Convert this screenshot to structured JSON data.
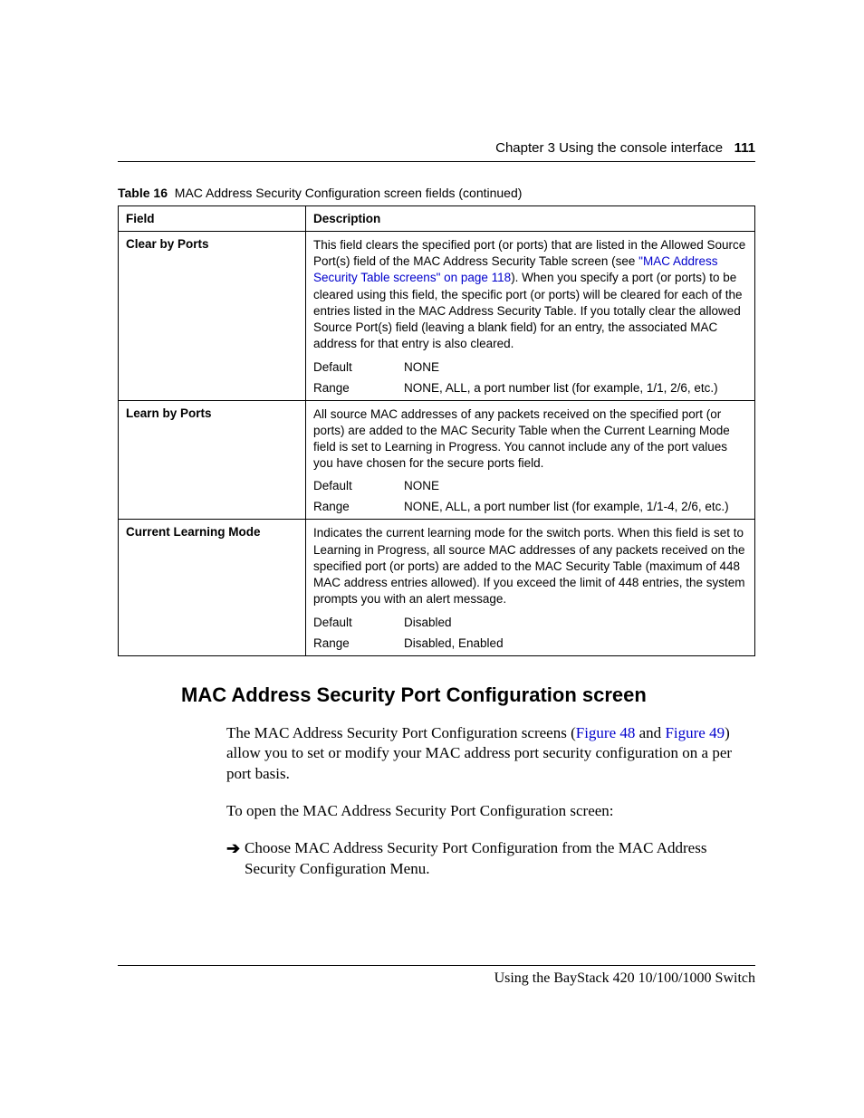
{
  "header": {
    "chapter": "Chapter 3  Using the console interface",
    "page": "111"
  },
  "table": {
    "caption_label": "Table 16",
    "caption_text": "MAC Address Security Configuration screen fields (continued)",
    "col_field": "Field",
    "col_desc": "Description",
    "rows": [
      {
        "field": "Clear by Ports",
        "desc_pre": "This field clears the specified port (or ports) that are listed in the Allowed Source Port(s) field of the MAC Address Security Table screen (see ",
        "link": "\"MAC Address Security Table screens\" on page 118",
        "desc_post": "). When you specify a port (or ports) to be cleared using this field, the specific port (or ports) will be cleared for each of the entries listed in the MAC Address Security Table. If you totally clear the allowed Source Port(s) field (leaving a blank field) for an entry, the associated MAC address for that entry is also cleared.",
        "default_label": "Default",
        "default_value": "NONE",
        "range_label": "Range",
        "range_value": "NONE, ALL, a port number list (for example, 1/1, 2/6, etc.)"
      },
      {
        "field": "Learn by Ports",
        "desc": "All source MAC addresses of any packets received on the specified port (or ports) are added to the MAC Security Table when the Current Learning Mode field is set to Learning in Progress. You cannot include any of the port values you have chosen for the secure ports field.",
        "default_label": "Default",
        "default_value": "NONE",
        "range_label": "Range",
        "range_value": "NONE, ALL, a port number list (for example, 1/1-4, 2/6, etc.)"
      },
      {
        "field": "Current Learning Mode",
        "desc": "Indicates the current learning mode for the switch ports. When this field is set to Learning in Progress, all source MAC addresses of any packets received on the specified port (or ports) are added to the MAC Security Table (maximum of 448 MAC address entries allowed). If you exceed the limit of 448 entries, the system prompts you with an alert message.",
        "default_label": "Default",
        "default_value": "Disabled",
        "range_label": "Range",
        "range_value": "Disabled, Enabled"
      }
    ]
  },
  "section": {
    "heading": "MAC Address Security Port Configuration screen",
    "para1_pre": "The MAC Address Security Port Configuration screens (",
    "para1_link1": "Figure 48",
    "para1_mid": " and ",
    "para1_link2": "Figure 49",
    "para1_post": ") allow you to set or modify your MAC address port security configuration on a per port basis.",
    "para2": "To open the MAC Address Security Port Configuration screen:",
    "step": "Choose MAC Address Security Port Configuration from the MAC Address Security Configuration Menu."
  },
  "footer": "Using the BayStack 420 10/100/1000 Switch"
}
